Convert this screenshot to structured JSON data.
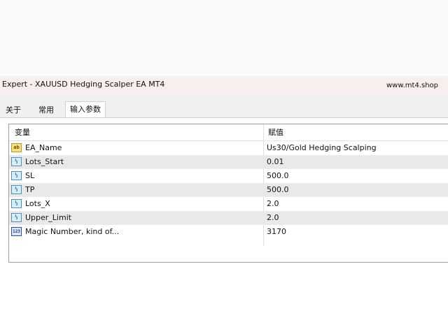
{
  "window": {
    "title": "Expert - XAUUSD Hedging Scalper EA MT4",
    "site": "www.mt4.shop"
  },
  "tabs": [
    {
      "label": "关于"
    },
    {
      "label": "常用"
    },
    {
      "label": "输入参数",
      "active": true
    }
  ],
  "grid": {
    "columns": {
      "variable": "变量",
      "value": "赋值"
    },
    "rows": [
      {
        "icon": "ab",
        "icon_name": "string-type-icon",
        "name": "EA_Name",
        "value": "Us30/Gold Hedging Scalping"
      },
      {
        "icon": "½",
        "icon_name": "double-type-icon",
        "name": "Lots_Start",
        "value": "0.01"
      },
      {
        "icon": "½",
        "icon_name": "double-type-icon",
        "name": "SL",
        "value": "500.0"
      },
      {
        "icon": "½",
        "icon_name": "double-type-icon",
        "name": "TP",
        "value": "500.0"
      },
      {
        "icon": "½",
        "icon_name": "double-type-icon",
        "name": "Lots_X",
        "value": "2.0"
      },
      {
        "icon": "½",
        "icon_name": "double-type-icon",
        "name": "Upper_Limit",
        "value": "2.0"
      },
      {
        "icon": "123",
        "icon_name": "integer-type-icon",
        "name": "Magic Number, kind of...",
        "value": "3170"
      }
    ]
  }
}
